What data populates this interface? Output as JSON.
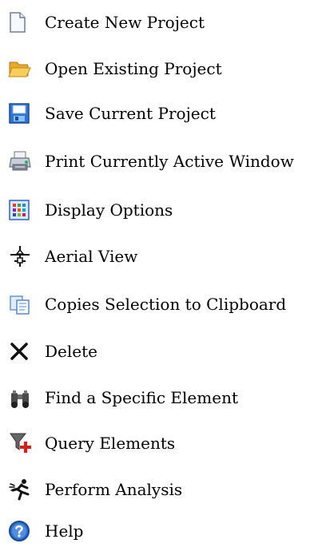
{
  "legend": {
    "items": [
      {
        "icon": "new-document-icon",
        "label": "Create New Project"
      },
      {
        "icon": "open-folder-icon",
        "label": "Open Existing Project"
      },
      {
        "icon": "save-disk-icon",
        "label": "Save Current Project"
      },
      {
        "icon": "printer-icon",
        "label": "Print Currently Active Window"
      },
      {
        "icon": "display-options-grid-icon",
        "label": "Display Options"
      },
      {
        "icon": "aerial-view-icon",
        "label": "Aerial View"
      },
      {
        "icon": "copy-icon",
        "label": "Copies Selection to Clipboard"
      },
      {
        "icon": "delete-x-icon",
        "label": "Delete"
      },
      {
        "icon": "binoculars-icon",
        "label": "Find a Specific Element"
      },
      {
        "icon": "query-filter-icon",
        "label": "Query Elements"
      },
      {
        "icon": "running-man-icon",
        "label": "Perform Analysis"
      },
      {
        "icon": "help-icon",
        "label": "Help"
      }
    ]
  },
  "colors": {
    "text": "#000000",
    "accent_blue": "#2f6fc8",
    "folder_yellow": "#f2c14e",
    "delete_dark": "#111111",
    "query_red": "#d51f1f"
  }
}
